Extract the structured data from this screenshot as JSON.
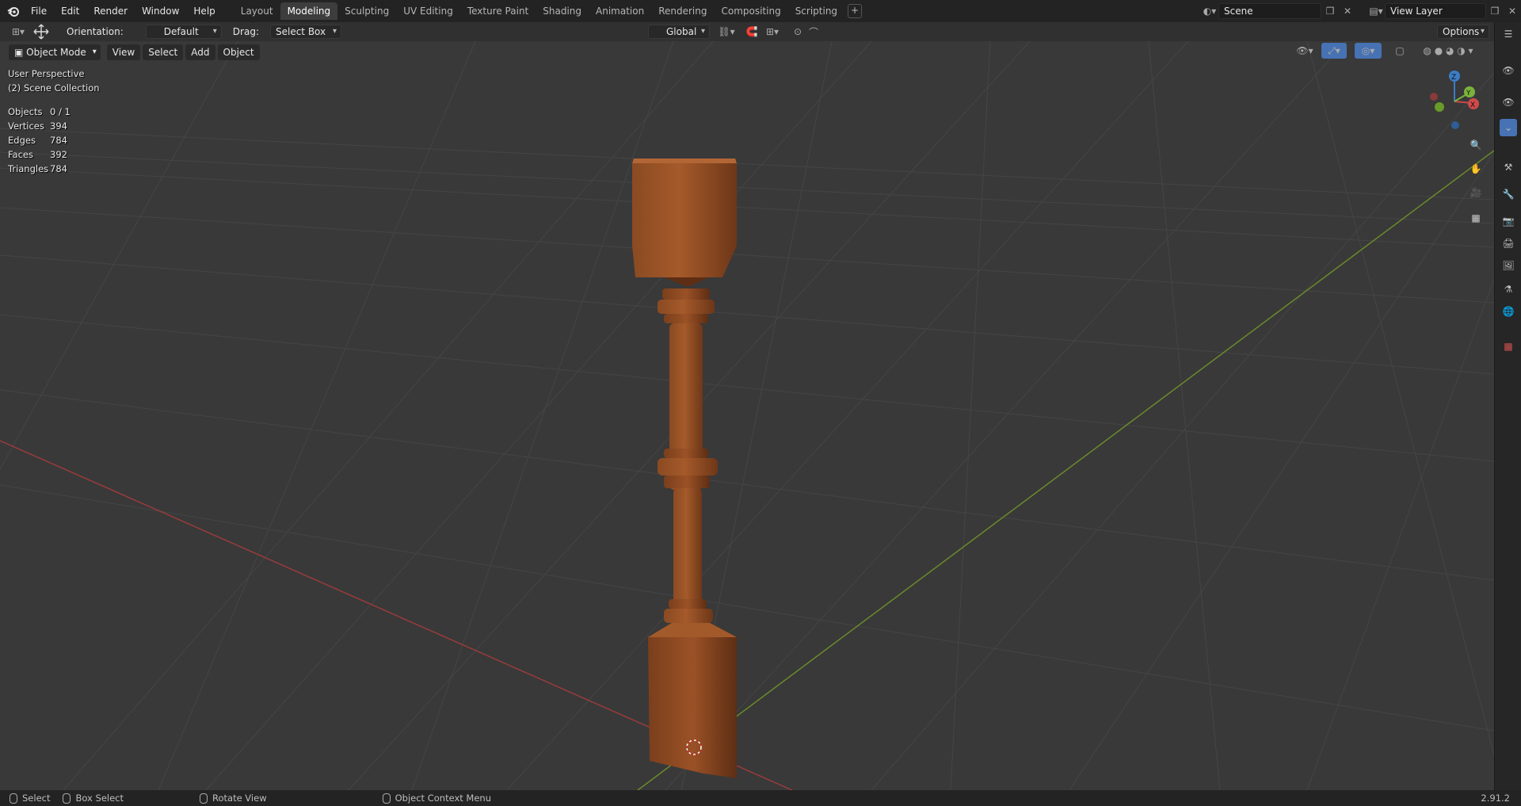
{
  "menu": [
    "File",
    "Edit",
    "Render",
    "Window",
    "Help"
  ],
  "workspaces": [
    "Layout",
    "Modeling",
    "Sculpting",
    "UV Editing",
    "Texture Paint",
    "Shading",
    "Animation",
    "Rendering",
    "Compositing",
    "Scripting"
  ],
  "active_workspace": "Modeling",
  "scene": "Scene",
  "view_layer": "View Layer",
  "toolheader": {
    "orientation_label": "Orientation:",
    "orientation_value": "Default",
    "drag_label": "Drag:",
    "drag_value": "Select Box",
    "transform_orientation": "Global",
    "options": "Options"
  },
  "viewheader": {
    "mode": "Object Mode",
    "view": "View",
    "select": "Select",
    "add": "Add",
    "object": "Object"
  },
  "viewport": {
    "perspective": "User Perspective",
    "collection": "(2) Scene Collection",
    "stats": [
      {
        "k": "Objects",
        "v": "0 / 1"
      },
      {
        "k": "Vertices",
        "v": "394"
      },
      {
        "k": "Edges",
        "v": "784"
      },
      {
        "k": "Faces",
        "v": "392"
      },
      {
        "k": "Triangles",
        "v": "784"
      }
    ],
    "gizmo": {
      "x": "X",
      "y": "Y",
      "z": "Z"
    }
  },
  "statusbar": {
    "select": "Select",
    "box_select": "Box Select",
    "rotate": "Rotate View",
    "context": "Object Context Menu",
    "version": "2.91.2"
  },
  "icons": [
    "blender-logo-icon",
    "move-tool-icon",
    "snap-icon",
    "proportional-icon",
    "overlay-icon",
    "shading-icon",
    "zoom-icon",
    "pan-icon",
    "camera-icon",
    "grid-icon"
  ]
}
